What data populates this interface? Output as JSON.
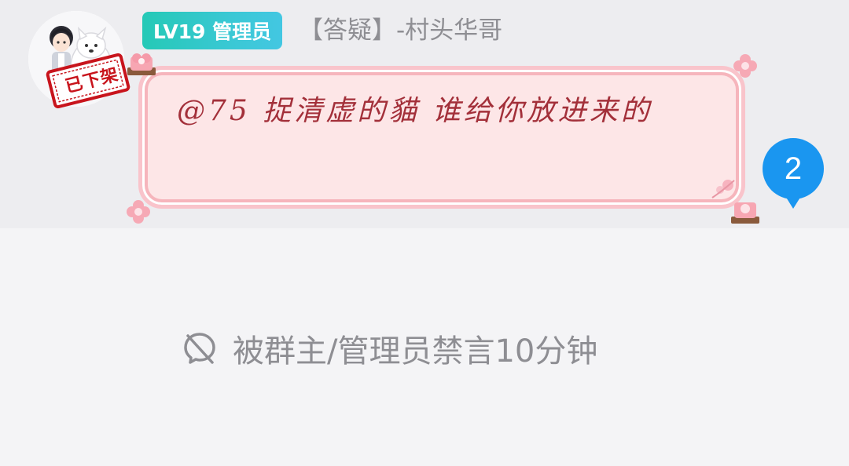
{
  "message": {
    "level_badge": "LV19 管理员",
    "sender_name": "【答疑】-村头华哥",
    "avatar_stamp": "已下架",
    "text": "@75 捉清虚的貓 谁给你放进来的",
    "unread_count": "2"
  },
  "footer": {
    "mute_notice": "被群主/管理员禁言10分钟"
  },
  "icons": {
    "mute": "mute-icon",
    "flower": "flower-icon",
    "gift": "gift-icon"
  },
  "colors": {
    "badge_gradient_start": "#25c9b6",
    "badge_gradient_end": "#43c7e2",
    "bubble_bg": "#fde6e7",
    "bubble_text": "#a3303a",
    "unread_badge": "#1a96f0",
    "muted_text": "#8e8e93"
  }
}
